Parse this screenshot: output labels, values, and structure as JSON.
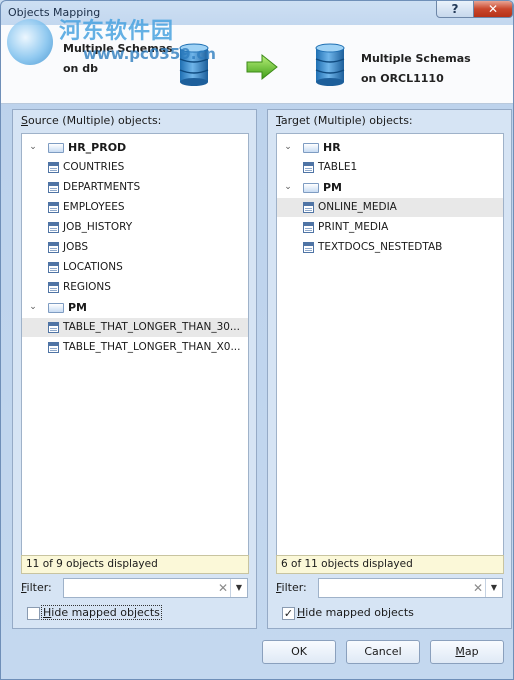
{
  "window": {
    "title": "Objects Mapping",
    "help_glyph": "?",
    "close_glyph": "✕"
  },
  "watermark": {
    "brand": "河东软件园",
    "url": "www.pc0359.cn"
  },
  "header": {
    "source": {
      "line1": "Multiple Schemas",
      "line2": "on db"
    },
    "target": {
      "line1": "Multiple Schemas",
      "line2": "on ORCL1110"
    }
  },
  "source_panel": {
    "title_underlined": "S",
    "title_rest": "ource (Multiple) objects:",
    "tree": [
      {
        "kind": "group",
        "label": "HR_PROD"
      },
      {
        "kind": "table",
        "label": "COUNTRIES"
      },
      {
        "kind": "table",
        "label": "DEPARTMENTS"
      },
      {
        "kind": "table",
        "label": "EMPLOYEES"
      },
      {
        "kind": "table",
        "label": "JOB_HISTORY"
      },
      {
        "kind": "table",
        "label": "JOBS"
      },
      {
        "kind": "table",
        "label": "LOCATIONS"
      },
      {
        "kind": "table",
        "label": "REGIONS"
      },
      {
        "kind": "group",
        "label": "PM"
      },
      {
        "kind": "table",
        "label": "TABLE_THAT_LONGER_THAN_30...",
        "selected": true
      },
      {
        "kind": "table",
        "label": "TABLE_THAT_LONGER_THAN_X0..."
      }
    ],
    "status": "11 of 9 objects displayed",
    "filter_label_underlined": "F",
    "filter_label_rest": "ilter:",
    "filter_value": "",
    "hide_label_underlined": "H",
    "hide_label_rest": "ide mapped objects",
    "hide_checked": false
  },
  "target_panel": {
    "title_underlined": "T",
    "title_rest": "arget (Multiple) objects:",
    "tree": [
      {
        "kind": "group",
        "label": "HR"
      },
      {
        "kind": "table",
        "label": "TABLE1"
      },
      {
        "kind": "group",
        "label": "PM"
      },
      {
        "kind": "table",
        "label": "ONLINE_MEDIA",
        "selected": true
      },
      {
        "kind": "table",
        "label": "PRINT_MEDIA"
      },
      {
        "kind": "table",
        "label": "TEXTDOCS_NESTEDTAB"
      }
    ],
    "status": "6 of 11 objects displayed",
    "filter_label_underlined": "F",
    "filter_label_rest": "ilter:",
    "filter_value": "",
    "hide_label_underlined": "H",
    "hide_label_rest": "ide mapped objects",
    "hide_checked": true
  },
  "buttons": {
    "ok": "OK",
    "cancel": "Cancel",
    "map_underlined": "M",
    "map_rest": "ap"
  },
  "glyphs": {
    "check": "✓",
    "clear": "✕",
    "dropdown": "▼",
    "collapse": "⌄"
  }
}
